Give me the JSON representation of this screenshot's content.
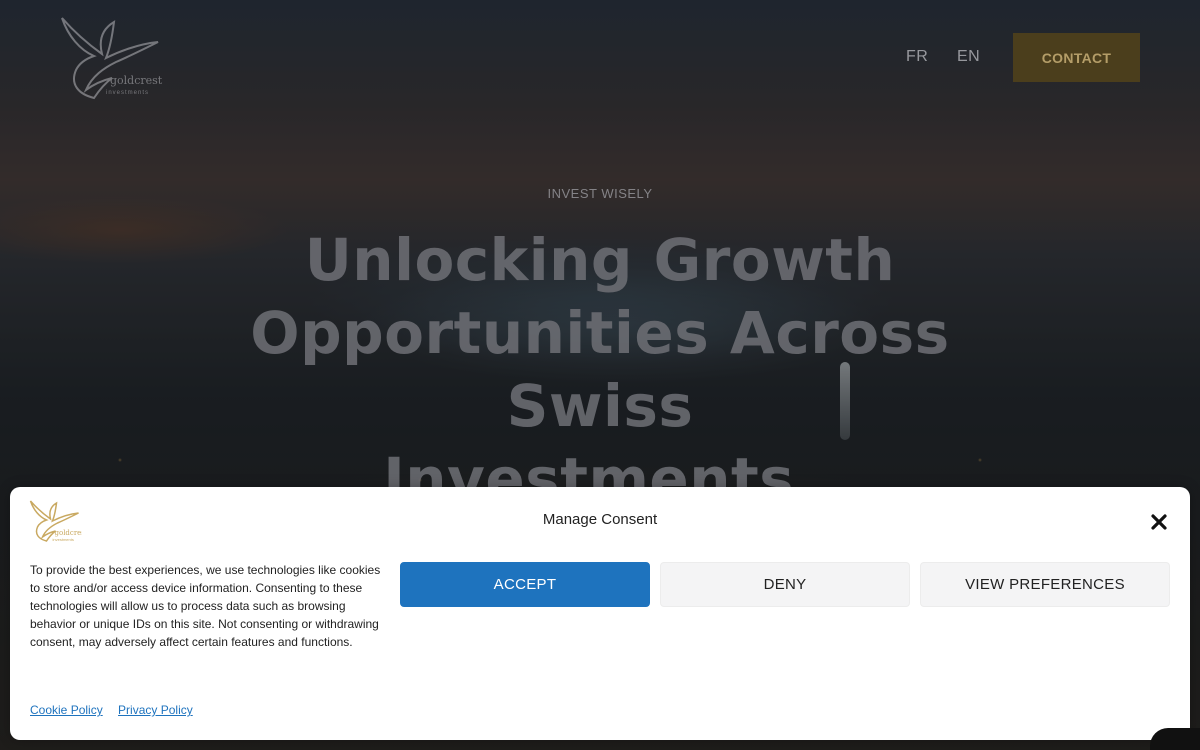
{
  "header": {
    "logo_name": "goldcrest",
    "logo_tagline": "investments",
    "languages": [
      "FR",
      "EN"
    ],
    "contact_label": "CONTACT"
  },
  "hero": {
    "eyebrow": "INVEST WISELY",
    "headline_lines": [
      "Unlocking Growth",
      "Opportunities Across Swiss",
      "Investments."
    ]
  },
  "consent": {
    "title": "Manage Consent",
    "message": "To provide the best experiences, we use technologies like cookies to store and/or access device information. Consenting to these technologies will allow us to process data such as browsing behavior or unique IDs on this site. Not consenting or withdrawing consent, may adversely affect certain features and functions.",
    "accept_label": "ACCEPT",
    "deny_label": "DENY",
    "preferences_label": "VIEW PREFERENCES",
    "links": [
      "Cookie Policy",
      "Privacy Policy"
    ],
    "close_icon": "close-icon"
  },
  "colors": {
    "accent_blue": "#1e73be",
    "contact_gold": "#4b3e1c",
    "logo_gold": "#c9a961"
  }
}
